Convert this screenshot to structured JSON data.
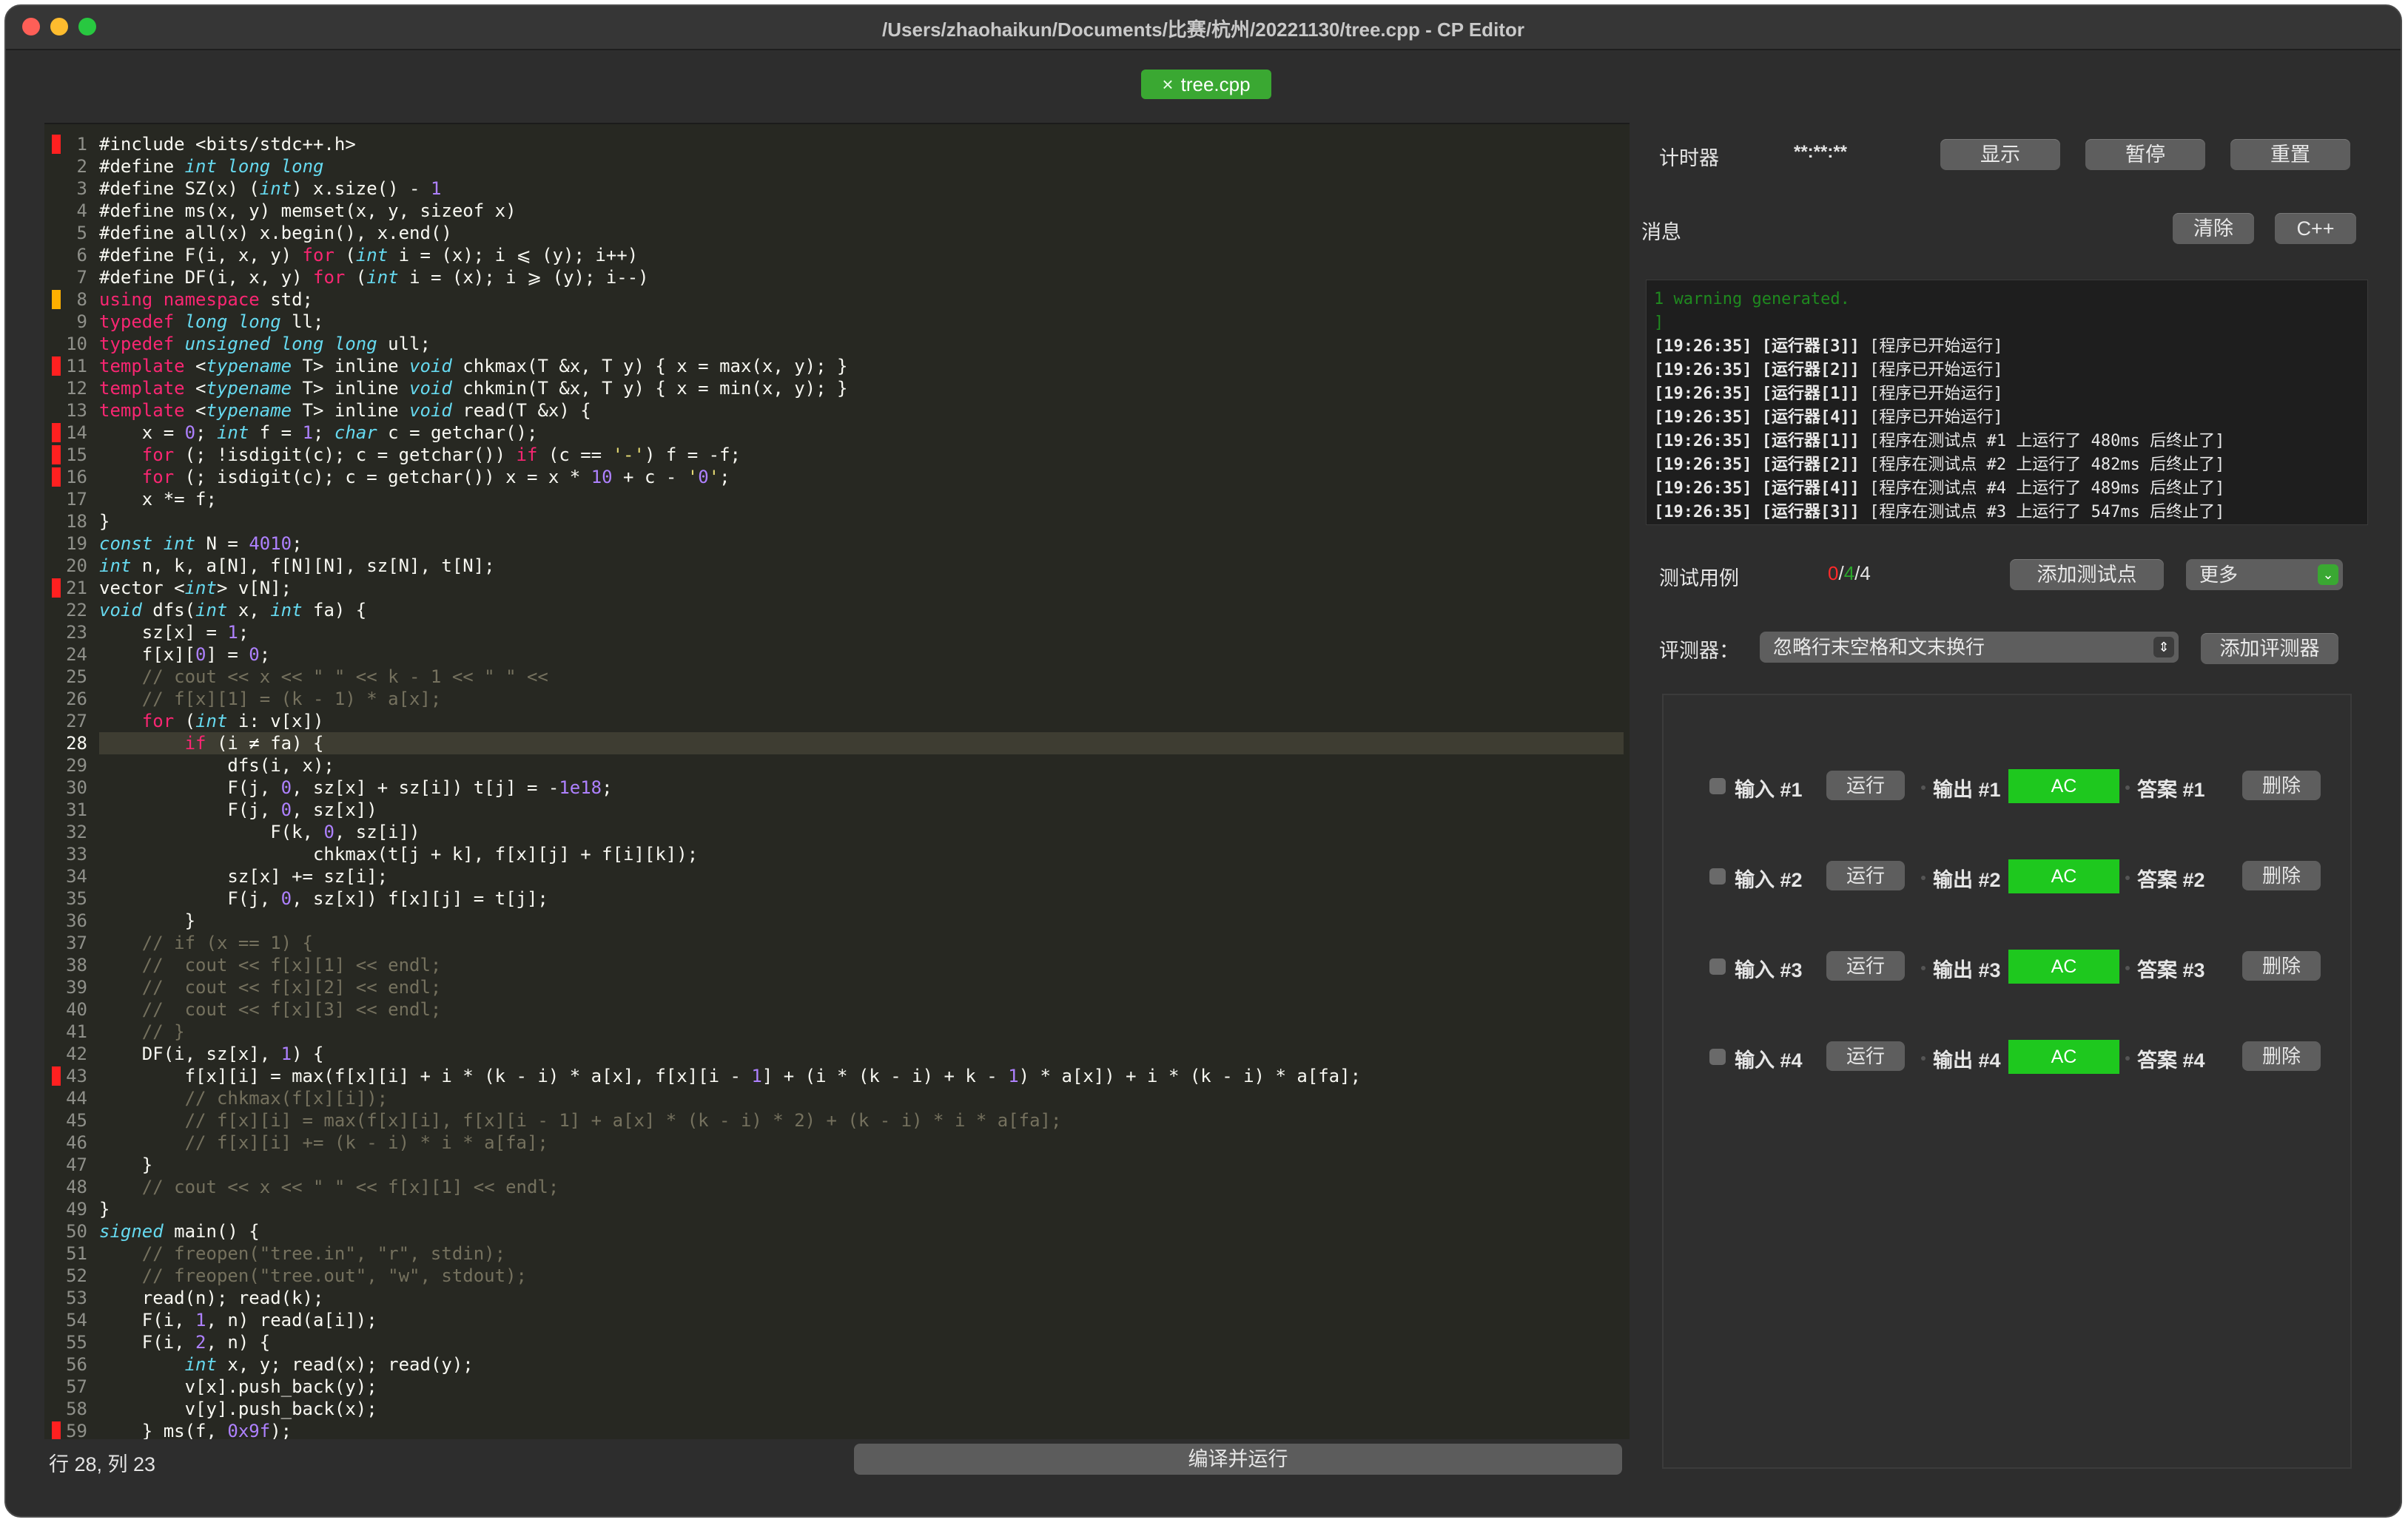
{
  "window": {
    "title": "/Users/zhaohaikun/Documents/比赛/杭州/20221130/tree.cpp - CP Editor",
    "traffic_lights": {
      "close": "#fe5f57",
      "minimize": "#febc2e",
      "maximize": "#28c840"
    }
  },
  "tab": {
    "label": "tree.cpp",
    "close_icon": "×"
  },
  "editor": {
    "line_count": 59,
    "current_line": 28,
    "gutter_marks": {
      "1": "#ff2020",
      "8": "#ffb000",
      "11": "#ff2020",
      "14": "#ff2020",
      "15": "#ff2020",
      "16": "#ff2020",
      "21": "#ff2020",
      "43": "#ff2020",
      "59": "#ff2020"
    },
    "lines": [
      "#include <bits/stdc++.h>",
      "#define int long long",
      "#define SZ(x) (int) x.size() - 1",
      "#define ms(x, y) memset(x, y, sizeof x)",
      "#define all(x) x.begin(), x.end()",
      "#define F(i, x, y) for (int i = (x); i ⩽ (y); i++)",
      "#define DF(i, x, y) for (int i = (x); i ⩾ (y); i--)",
      "using namespace std;",
      "typedef long long ll;",
      "typedef unsigned long long ull;",
      "template <typename T> inline void chkmax(T &x, T y) { x = max(x, y); }",
      "template <typename T> inline void chkmin(T &x, T y) { x = min(x, y); }",
      "template <typename T> inline void read(T &x) {",
      "    x = 0; int f = 1; char c = getchar();",
      "    for (; !isdigit(c); c = getchar()) if (c == '-') f = -f;",
      "    for (; isdigit(c); c = getchar()) x = x * 10 + c - '0';",
      "    x *= f;",
      "}",
      "const int N = 4010;",
      "int n, k, a[N], f[N][N], sz[N], t[N];",
      "vector <int> v[N];",
      "void dfs(int x, int fa) {",
      "    sz[x] = 1;",
      "    f[x][0] = 0;",
      "    // cout << x << \" \" << k - 1 << \" \" <<",
      "    // f[x][1] = (k - 1) * a[x];",
      "    for (int i: v[x])",
      "        if (i ≠ fa) {",
      "            dfs(i, x);",
      "            F(j, 0, sz[x] + sz[i]) t[j] = -1e18;",
      "            F(j, 0, sz[x])",
      "                F(k, 0, sz[i])",
      "                    chkmax(t[j + k], f[x][j] + f[i][k]);",
      "            sz[x] += sz[i];",
      "            F(j, 0, sz[x]) f[x][j] = t[j];",
      "        }",
      "    // if (x == 1) {",
      "    //  cout << f[x][1] << endl;",
      "    //  cout << f[x][2] << endl;",
      "    //  cout << f[x][3] << endl;",
      "    // }",
      "    DF(i, sz[x], 1) {",
      "        f[x][i] = max(f[x][i] + i * (k - i) * a[x], f[x][i - 1] + (i * (k - i) + k - 1) * a[x]) + i * (k - i) * a[fa];",
      "        // chkmax(f[x][i]);",
      "        // f[x][i] = max(f[x][i], f[x][i - 1] + a[x] * (k - i) * 2) + (k - i) * i * a[fa];",
      "        // f[x][i] += (k - i) * i * a[fa];",
      "    }",
      "    // cout << x << \" \" << f[x][1] << endl;",
      "}",
      "signed main() {",
      "    // freopen(\"tree.in\", \"r\", stdin);",
      "    // freopen(\"tree.out\", \"w\", stdout);",
      "    read(n); read(k);",
      "    F(i, 1, n) read(a[i]);",
      "    F(i, 2, n) {",
      "        int x, y; read(x); read(y);",
      "        v[x].push_back(y);",
      "        v[y].push_back(x);",
      "    } ms(f, 0x9f);"
    ],
    "status": "行 28, 列 23",
    "compile_run_label": "编译并运行"
  },
  "timer": {
    "label": "计时器",
    "value": "**:**:**",
    "show_label": "显示",
    "pause_label": "暂停",
    "reset_label": "重置"
  },
  "messages": {
    "label": "消息",
    "clear_label": "清除",
    "lang_label": "C++",
    "console": [
      {
        "ts": "",
        "runner": "",
        "text": "1 warning generated.",
        "tone": "green"
      },
      {
        "ts": "",
        "runner": "",
        "text": "]",
        "tone": "green"
      },
      {
        "ts": "[19:26:35]",
        "runner": "[运行器[3]]",
        "text": "[程序已开始运行]"
      },
      {
        "ts": "[19:26:35]",
        "runner": "[运行器[2]]",
        "text": "[程序已开始运行]"
      },
      {
        "ts": "[19:26:35]",
        "runner": "[运行器[1]]",
        "text": "[程序已开始运行]"
      },
      {
        "ts": "[19:26:35]",
        "runner": "[运行器[4]]",
        "text": "[程序已开始运行]"
      },
      {
        "ts": "[19:26:35]",
        "runner": "[运行器[1]]",
        "text": "[程序在测试点 #1 上运行了 480ms 后终止了]"
      },
      {
        "ts": "[19:26:35]",
        "runner": "[运行器[2]]",
        "text": "[程序在测试点 #2 上运行了 482ms 后终止了]"
      },
      {
        "ts": "[19:26:35]",
        "runner": "[运行器[4]]",
        "text": "[程序在测试点 #4 上运行了 489ms 后终止了]"
      },
      {
        "ts": "[19:26:35]",
        "runner": "[运行器[3]]",
        "text": "[程序在测试点 #3 上运行了 547ms 后终止了]"
      }
    ]
  },
  "testcases": {
    "label": "测试用例",
    "count_fail": "0",
    "sep1": "/",
    "count_pass": "4",
    "sep2": "/",
    "count_total": "4",
    "add_label": "添加测试点",
    "more_label": "更多",
    "checker_label": "评测器：",
    "checker_value": "忽略行末空格和文末换行",
    "add_checker_label": "添加评测器",
    "rows": [
      {
        "input": "输入 #1",
        "run": "运行",
        "output": "输出 #1",
        "verdict": "AC",
        "answer": "答案 #1",
        "delete": "删除"
      },
      {
        "input": "输入 #2",
        "run": "运行",
        "output": "输出 #2",
        "verdict": "AC",
        "answer": "答案 #2",
        "delete": "删除"
      },
      {
        "input": "输入 #3",
        "run": "运行",
        "output": "输出 #3",
        "verdict": "AC",
        "answer": "答案 #3",
        "delete": "删除"
      },
      {
        "input": "输入 #4",
        "run": "运行",
        "output": "输出 #4",
        "verdict": "AC",
        "answer": "答案 #4",
        "delete": "删除"
      }
    ]
  },
  "colors": {
    "accent": "#3aa832",
    "verdict_ac": "#1ec81e",
    "fail": "#ff2a2a",
    "pass": "#2aa62a"
  }
}
